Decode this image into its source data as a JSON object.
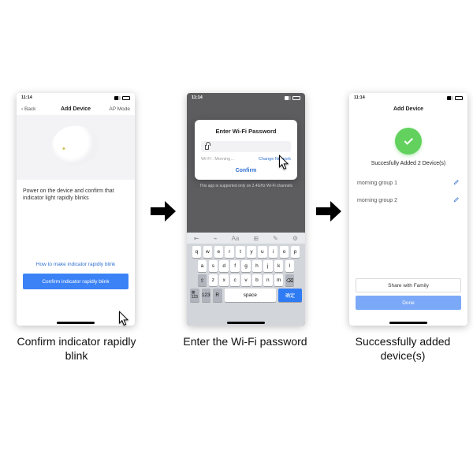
{
  "status_time": "11:14",
  "phone1": {
    "back": "Back",
    "title": "Add Device",
    "mode": "AP Mode",
    "instruction": "Power on the device and confirm that indicator light rapidly blinks",
    "help_link": "How to make indicator rapidly blink",
    "cta": "Confirm indicator rapidly blink"
  },
  "phone2": {
    "modal_title": "Enter Wi-Fi Password",
    "network": "Wi-Fi : Morning…",
    "change": "Change Network",
    "confirm": "Confirm",
    "hint": "This app is supported only on 2.4GHz Wi-Fi channels",
    "keyboard": {
      "row1": [
        "q",
        "w",
        "e",
        "r",
        "t",
        "y",
        "u",
        "i",
        "o",
        "p"
      ],
      "row2": [
        "a",
        "s",
        "d",
        "f",
        "g",
        "h",
        "j",
        "k",
        "l"
      ],
      "row3": [
        "z",
        "x",
        "c",
        "v",
        "b",
        "n",
        "m"
      ],
      "shift": "⇧",
      "del": "⌫",
      "num": "123",
      "globe": "🌐",
      "mic": "R",
      "space": "space",
      "return": "确定"
    }
  },
  "phone3": {
    "title": "Add Device",
    "success": "Succesfully Added 2 Device(s)",
    "items": [
      "morning group 1",
      "morning group 2"
    ],
    "share": "Share with Family",
    "done": "Done"
  },
  "captions": {
    "c1": "Confirm indicator rapidly blink",
    "c2": "Enter the Wi-Fi password",
    "c3": "Successfully added device(s)"
  }
}
